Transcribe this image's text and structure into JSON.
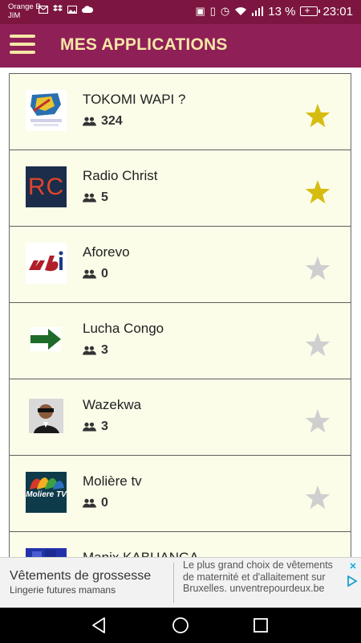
{
  "status_bar": {
    "carrier_line1": "Orange B",
    "carrier_line2": "JIM",
    "battery": "13 %",
    "time": "23:01"
  },
  "app_bar": {
    "title": "MES APPLICATIONS"
  },
  "apps": [
    {
      "name": "TOKOMI WAPI ?",
      "users": "324",
      "favorite": true,
      "icon": "tokomi-logo-icon"
    },
    {
      "name": "Radio Christ",
      "users": "5",
      "favorite": true,
      "icon": "rc-logo-icon",
      "icon_text": "RC"
    },
    {
      "name": "Aforevo",
      "users": "0",
      "favorite": false,
      "icon": "aforevo-logo-icon"
    },
    {
      "name": "Lucha Congo",
      "users": "3",
      "favorite": false,
      "icon": "green-arrow-icon"
    },
    {
      "name": "Wazekwa",
      "users": "3",
      "favorite": false,
      "icon": "person-photo-icon"
    },
    {
      "name": "Molière tv",
      "users": "0",
      "favorite": false,
      "icon": "moliere-tv-logo-icon",
      "icon_text": "Moliere TV"
    },
    {
      "name": "Manix KABUANGA",
      "users": "",
      "favorite": false,
      "icon": "manix-logo-icon"
    }
  ],
  "colors": {
    "status_bar": "#7c1640",
    "app_bar": "#8f1f57",
    "title": "#f5e6a6",
    "row_bg": "#fbfde9",
    "star_active": "#d6bc10",
    "star_inactive": "#cfcfcf"
  },
  "ad": {
    "title": "Vêtements de grossesse",
    "subtitle": "Lingerie futures mamans",
    "description": "Le plus grand choix de vêtements de maternité et d'allaitement sur Bruxelles. unventrepourdeux.be"
  }
}
